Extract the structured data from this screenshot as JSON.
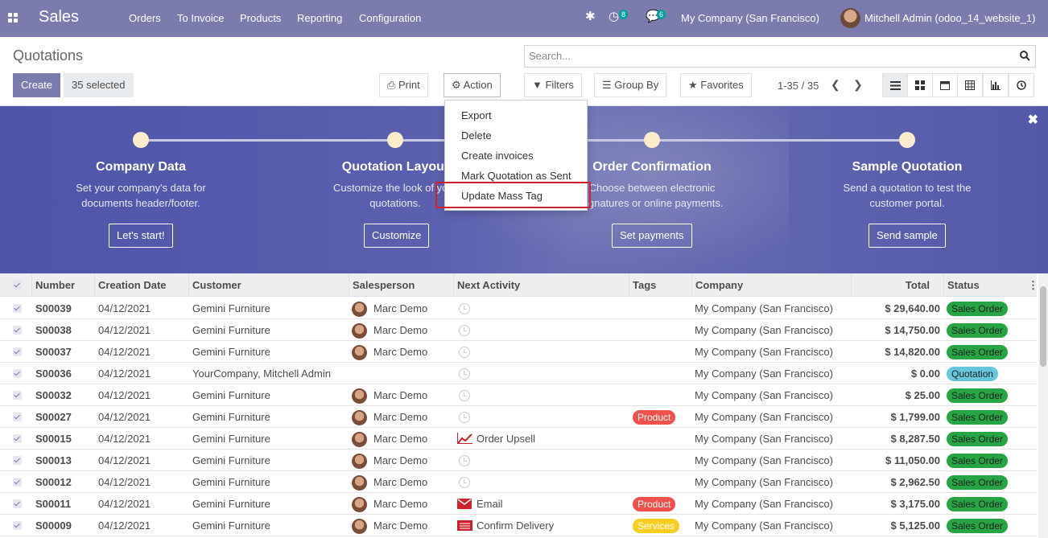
{
  "nav": {
    "brand": "Sales",
    "menus": [
      "Orders",
      "To Invoice",
      "Products",
      "Reporting",
      "Configuration"
    ],
    "activity_count": "8",
    "message_count": "6",
    "company": "My Company (San Francisco)",
    "user": "Mitchell Admin (odoo_14_website_1)"
  },
  "page": {
    "title": "Quotations",
    "create_label": "Create",
    "selected_label": "35 selected",
    "print_label": "Print",
    "action_label": "Action",
    "search_placeholder": "Search...",
    "filters_label": "Filters",
    "groupby_label": "Group By",
    "favorites_label": "Favorites",
    "pager": "1-35 / 35"
  },
  "action_menu": [
    "Export",
    "Delete",
    "Create invoices",
    "Mark Quotation as Sent",
    "Update Mass Tag"
  ],
  "banner": {
    "steps": [
      {
        "title": "Company Data",
        "desc1": "Set your company's data for",
        "desc2": "documents header/footer.",
        "button": "Let's start!"
      },
      {
        "title": "Quotation Layout",
        "desc1": "Customize the look of your",
        "desc2": "quotations.",
        "button": "Customize"
      },
      {
        "title": "Order Confirmation",
        "desc1": "Choose between electronic",
        "desc2": "signatures or online payments.",
        "button": "Set payments"
      },
      {
        "title": "Sample Quotation",
        "desc1": "Send a quotation to test the",
        "desc2": "customer portal.",
        "button": "Send sample"
      }
    ]
  },
  "table": {
    "headers": [
      "Number",
      "Creation Date",
      "Customer",
      "Salesperson",
      "Next Activity",
      "Tags",
      "Company",
      "Total",
      "Status"
    ],
    "rows": [
      {
        "number": "S00039",
        "date": "04/12/2021",
        "customer": "Gemini Furniture",
        "salesperson": "Marc Demo",
        "activity": "",
        "activity_icon": "clock",
        "tag": "",
        "company": "My Company (San Francisco)",
        "total": "$ 29,640.00",
        "status": "Sales Order"
      },
      {
        "number": "S00038",
        "date": "04/12/2021",
        "customer": "Gemini Furniture",
        "salesperson": "Marc Demo",
        "activity": "",
        "activity_icon": "clock",
        "tag": "",
        "company": "My Company (San Francisco)",
        "total": "$ 14,750.00",
        "status": "Sales Order"
      },
      {
        "number": "S00037",
        "date": "04/12/2021",
        "customer": "Gemini Furniture",
        "salesperson": "Marc Demo",
        "activity": "",
        "activity_icon": "clock",
        "tag": "",
        "company": "My Company (San Francisco)",
        "total": "$ 14,820.00",
        "status": "Sales Order"
      },
      {
        "number": "S00036",
        "date": "04/12/2021",
        "customer": "YourCompany, Mitchell Admin",
        "salesperson": "",
        "activity": "",
        "activity_icon": "clock",
        "tag": "",
        "company": "My Company (San Francisco)",
        "total": "$ 0.00",
        "status": "Quotation"
      },
      {
        "number": "S00032",
        "date": "04/12/2021",
        "customer": "Gemini Furniture",
        "salesperson": "Marc Demo",
        "activity": "",
        "activity_icon": "clock",
        "tag": "",
        "company": "My Company (San Francisco)",
        "total": "$ 25.00",
        "status": "Sales Order"
      },
      {
        "number": "S00027",
        "date": "04/12/2021",
        "customer": "Gemini Furniture",
        "salesperson": "Marc Demo",
        "activity": "",
        "activity_icon": "clock",
        "tag": "Product",
        "company": "My Company (San Francisco)",
        "total": "$ 1,799.00",
        "status": "Sales Order"
      },
      {
        "number": "S00015",
        "date": "04/12/2021",
        "customer": "Gemini Furniture",
        "salesperson": "Marc Demo",
        "activity": "Order Upsell",
        "activity_icon": "upsell",
        "tag": "",
        "company": "My Company (San Francisco)",
        "total": "$ 8,287.50",
        "status": "Sales Order"
      },
      {
        "number": "S00013",
        "date": "04/12/2021",
        "customer": "Gemini Furniture",
        "salesperson": "Marc Demo",
        "activity": "",
        "activity_icon": "clock",
        "tag": "",
        "company": "My Company (San Francisco)",
        "total": "$ 11,050.00",
        "status": "Sales Order"
      },
      {
        "number": "S00012",
        "date": "04/12/2021",
        "customer": "Gemini Furniture",
        "salesperson": "Marc Demo",
        "activity": "",
        "activity_icon": "clock",
        "tag": "",
        "company": "My Company (San Francisco)",
        "total": "$ 2,962.50",
        "status": "Sales Order"
      },
      {
        "number": "S00011",
        "date": "04/12/2021",
        "customer": "Gemini Furniture",
        "salesperson": "Marc Demo",
        "activity": "Email",
        "activity_icon": "email",
        "tag": "Product",
        "company": "My Company (San Francisco)",
        "total": "$ 3,175.00",
        "status": "Sales Order"
      },
      {
        "number": "S00009",
        "date": "04/12/2021",
        "customer": "Gemini Furniture",
        "salesperson": "Marc Demo",
        "activity": "Confirm Delivery",
        "activity_icon": "delivery",
        "tag": "Services",
        "company": "My Company (San Francisco)",
        "total": "$ 5,125.00",
        "status": "Sales Order"
      }
    ]
  },
  "colors": {
    "navbar": "#7c7bad",
    "highlight": "#d0202d",
    "tag_product": "#f0524b",
    "tag_services": "#f7cd1f",
    "status_sales_order": "#27a544",
    "status_quotation": "#65c6dc"
  }
}
